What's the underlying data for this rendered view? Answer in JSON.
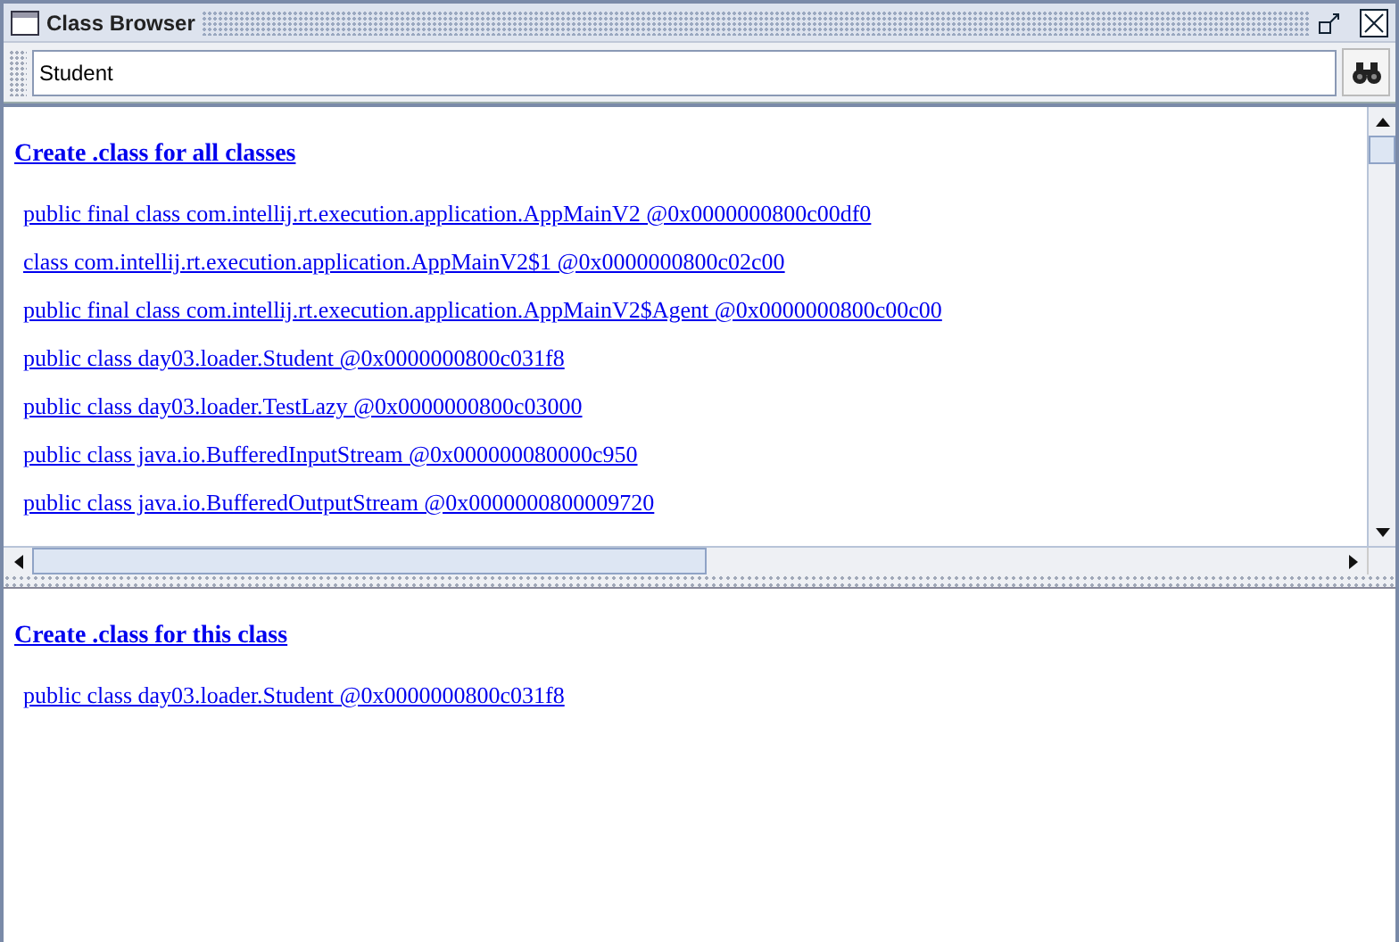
{
  "window": {
    "title": "Class Browser"
  },
  "search": {
    "value": "Student"
  },
  "top_pane": {
    "heading": "Create .class for all classes",
    "items": [
      "public final class com.intellij.rt.execution.application.AppMainV2 @0x0000000800c00df0",
      "class com.intellij.rt.execution.application.AppMainV2$1 @0x0000000800c02c00",
      "public final class com.intellij.rt.execution.application.AppMainV2$Agent @0x0000000800c00c00",
      "public class day03.loader.Student @0x0000000800c031f8",
      "public class day03.loader.TestLazy @0x0000000800c03000",
      "public class java.io.BufferedInputStream @0x000000080000c950",
      "public class java.io.BufferedOutputStream @0x0000000800009720"
    ]
  },
  "bottom_pane": {
    "heading": "Create .class for this class",
    "items": [
      "public class day03.loader.Student @0x0000000800c031f8"
    ]
  }
}
